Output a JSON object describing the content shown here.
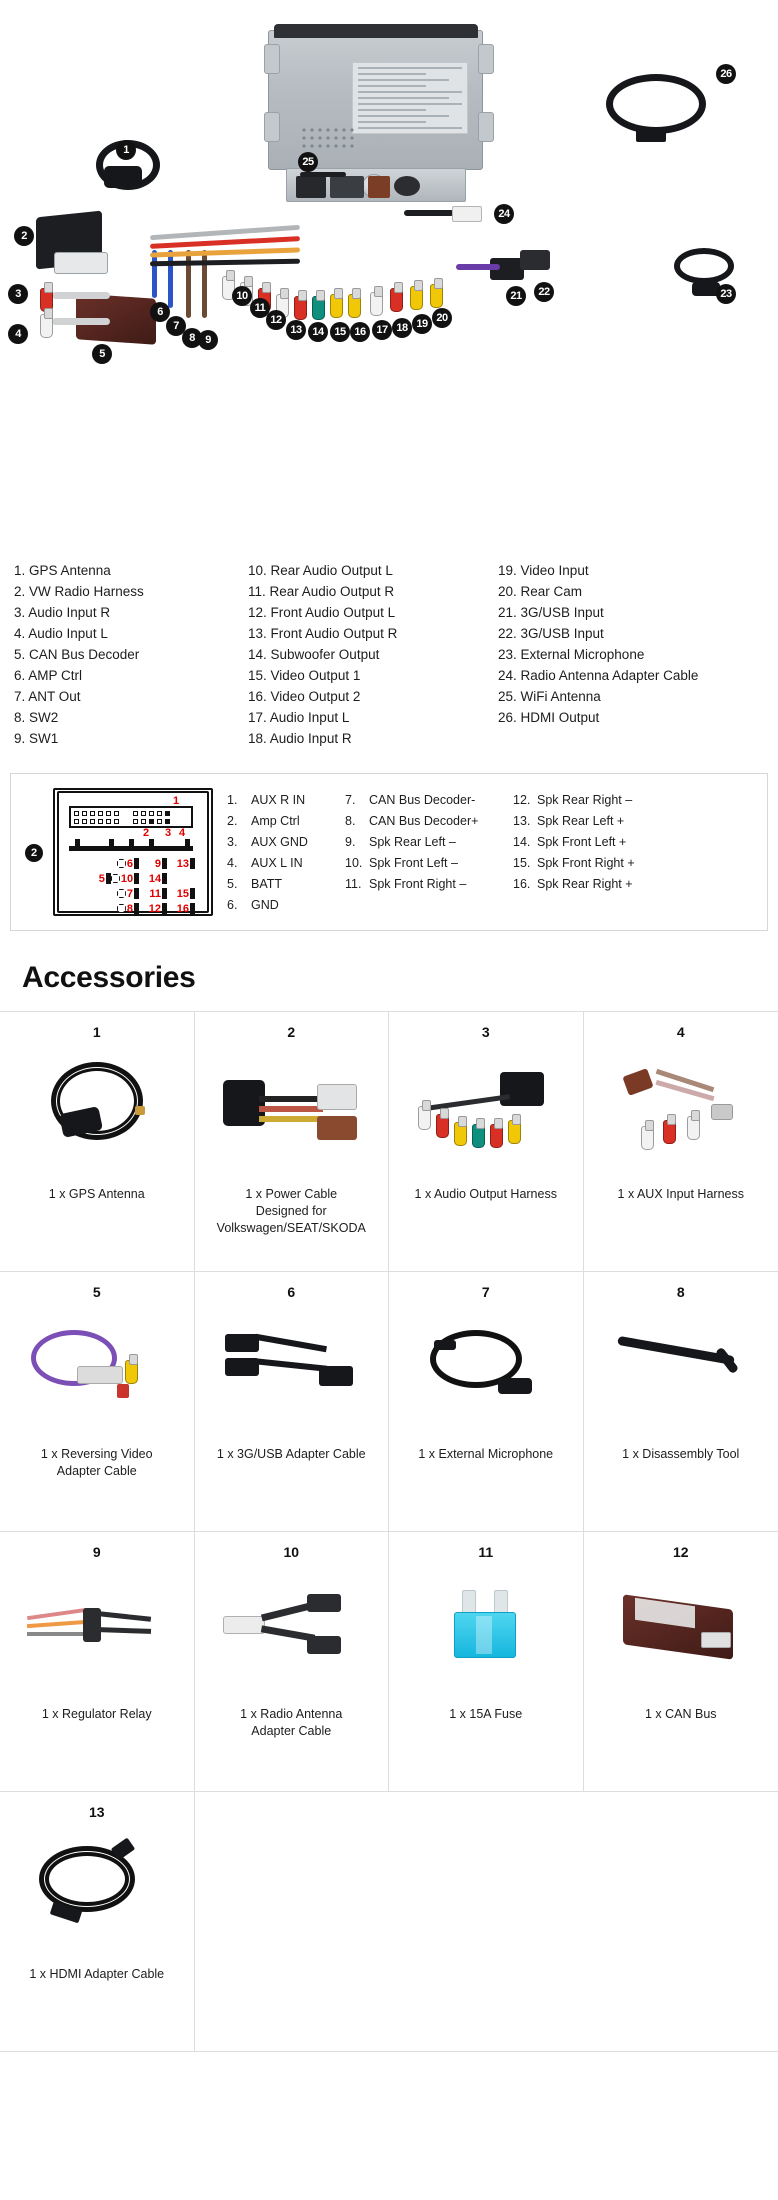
{
  "diagram": {
    "title": "wiring-diagram",
    "markers": [
      "1",
      "2",
      "3",
      "4",
      "5",
      "6",
      "7",
      "8",
      "9",
      "10",
      "11",
      "12",
      "13",
      "14",
      "15",
      "16",
      "17",
      "18",
      "19",
      "20",
      "21",
      "22",
      "23",
      "24",
      "25",
      "26"
    ]
  },
  "legend": {
    "column1": [
      "1. GPS Antenna",
      "2. VW Radio Harness",
      "3. Audio Input R",
      "4. Audio Input L",
      "5. CAN Bus Decoder",
      "6. AMP Ctrl",
      "7. ANT Out",
      "8. SW2",
      "9. SW1"
    ],
    "column2": [
      "10. Rear Audio Output L",
      "11. Rear Audio Output R",
      "12. Front Audio Output L",
      "13. Front Audio Output R",
      "14. Subwoofer Output",
      "15. Video Output 1",
      "16. Video Output 2",
      "17. Audio Input L",
      "18. Audio Input R"
    ],
    "column3": [
      "19. Video Input",
      "20. Rear Cam",
      "21. 3G/USB Input",
      "22. 3G/USB Input",
      "23. External Microphone",
      "24. Radio Antenna Adapter Cable",
      "25. WiFi Antenna",
      "26. HDMI Output"
    ]
  },
  "pinout": {
    "badge": "2",
    "diagram_labels": {
      "top_right": "1",
      "comb_2": "2",
      "comb_3": "3",
      "comb_4": "4",
      "matrix": [
        [
          "",
          "6",
          "9",
          "13"
        ],
        [
          "5",
          "10",
          "14",
          ""
        ],
        [
          "",
          "7",
          "11",
          "15"
        ],
        [
          "",
          "8",
          "12",
          "16"
        ]
      ]
    },
    "columns": [
      [
        {
          "n": "1.",
          "t": "AUX R IN"
        },
        {
          "n": "2.",
          "t": "Amp Ctrl"
        },
        {
          "n": "3.",
          "t": "AUX GND"
        },
        {
          "n": "4.",
          "t": "AUX L IN"
        },
        {
          "n": "5.",
          "t": "BATT"
        },
        {
          "n": "6.",
          "t": "GND"
        }
      ],
      [
        {
          "n": "7.",
          "t": "CAN Bus Decoder-"
        },
        {
          "n": "8.",
          "t": "CAN Bus Decoder+"
        },
        {
          "n": "9.",
          "t": "Spk Rear Left –"
        },
        {
          "n": "10.",
          "t": "Spk Front Left –"
        },
        {
          "n": "11.",
          "t": "Spk Front Right –"
        }
      ],
      [
        {
          "n": "12.",
          "t": "Spk Rear Right –"
        },
        {
          "n": "13.",
          "t": "Spk Rear Left +"
        },
        {
          "n": "14.",
          "t": "Spk Front Left +"
        },
        {
          "n": "15.",
          "t": "Spk Front Right +"
        },
        {
          "n": "16.",
          "t": "Spk Rear Right +"
        }
      ]
    ]
  },
  "accessories": {
    "heading": "Accessories",
    "items": [
      {
        "num": "1",
        "caption": "1 x GPS Antenna",
        "icon": "gps-antenna-icon"
      },
      {
        "num": "2",
        "caption": "1 x Power Cable\nDesigned for\nVolkswagen/SEAT/SKODA",
        "icon": "power-cable-icon"
      },
      {
        "num": "3",
        "caption": "1 x Audio Output Harness",
        "icon": "audio-output-harness-icon"
      },
      {
        "num": "4",
        "caption": "1 x AUX Input Harness",
        "icon": "aux-input-harness-icon"
      },
      {
        "num": "5",
        "caption": "1 x Reversing Video\nAdapter Cable",
        "icon": "reversing-video-cable-icon"
      },
      {
        "num": "6",
        "caption": "1 x 3G/USB Adapter Cable",
        "icon": "usb-adapter-cable-icon"
      },
      {
        "num": "7",
        "caption": "1 x External Microphone",
        "icon": "microphone-icon"
      },
      {
        "num": "8",
        "caption": "1 x Disassembly Tool",
        "icon": "disassembly-tool-icon"
      },
      {
        "num": "9",
        "caption": "1 x Regulator Relay",
        "icon": "regulator-relay-icon"
      },
      {
        "num": "10",
        "caption": "1 x Radio Antenna\nAdapter Cable",
        "icon": "radio-antenna-adapter-icon"
      },
      {
        "num": "11",
        "caption": "1 x 15A Fuse",
        "icon": "fuse-icon"
      },
      {
        "num": "12",
        "caption": "1 x CAN Bus",
        "icon": "can-bus-box-icon"
      },
      {
        "num": "13",
        "caption": "1 x HDMI Adapter Cable",
        "icon": "hdmi-cable-icon"
      }
    ]
  },
  "colors": {
    "marker_bg": "#111111",
    "red_number": "#e00000",
    "border": "#dddddd",
    "fuse_blue": "#2ec8e8",
    "can_bus_brown": "#5a2b24"
  }
}
